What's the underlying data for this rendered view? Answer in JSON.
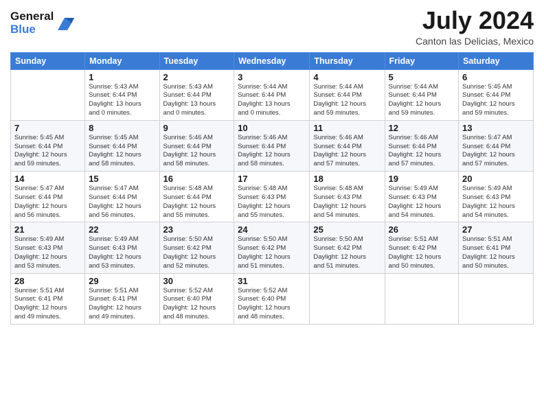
{
  "header": {
    "logo_line1": "General",
    "logo_line2": "Blue",
    "month_title": "July 2024",
    "subtitle": "Canton las Delicias, Mexico"
  },
  "weekdays": [
    "Sunday",
    "Monday",
    "Tuesday",
    "Wednesday",
    "Thursday",
    "Friday",
    "Saturday"
  ],
  "weeks": [
    [
      {
        "day": "",
        "info": ""
      },
      {
        "day": "1",
        "info": "Sunrise: 5:43 AM\nSunset: 6:44 PM\nDaylight: 13 hours\nand 0 minutes."
      },
      {
        "day": "2",
        "info": "Sunrise: 5:43 AM\nSunset: 6:44 PM\nDaylight: 13 hours\nand 0 minutes."
      },
      {
        "day": "3",
        "info": "Sunrise: 5:44 AM\nSunset: 6:44 PM\nDaylight: 13 hours\nand 0 minutes."
      },
      {
        "day": "4",
        "info": "Sunrise: 5:44 AM\nSunset: 6:44 PM\nDaylight: 12 hours\nand 59 minutes."
      },
      {
        "day": "5",
        "info": "Sunrise: 5:44 AM\nSunset: 6:44 PM\nDaylight: 12 hours\nand 59 minutes."
      },
      {
        "day": "6",
        "info": "Sunrise: 5:45 AM\nSunset: 6:44 PM\nDaylight: 12 hours\nand 59 minutes."
      }
    ],
    [
      {
        "day": "7",
        "info": "Sunrise: 5:45 AM\nSunset: 6:44 PM\nDaylight: 12 hours\nand 59 minutes."
      },
      {
        "day": "8",
        "info": "Sunrise: 5:45 AM\nSunset: 6:44 PM\nDaylight: 12 hours\nand 58 minutes."
      },
      {
        "day": "9",
        "info": "Sunrise: 5:46 AM\nSunset: 6:44 PM\nDaylight: 12 hours\nand 58 minutes."
      },
      {
        "day": "10",
        "info": "Sunrise: 5:46 AM\nSunset: 6:44 PM\nDaylight: 12 hours\nand 58 minutes."
      },
      {
        "day": "11",
        "info": "Sunrise: 5:46 AM\nSunset: 6:44 PM\nDaylight: 12 hours\nand 57 minutes."
      },
      {
        "day": "12",
        "info": "Sunrise: 5:46 AM\nSunset: 6:44 PM\nDaylight: 12 hours\nand 57 minutes."
      },
      {
        "day": "13",
        "info": "Sunrise: 5:47 AM\nSunset: 6:44 PM\nDaylight: 12 hours\nand 57 minutes."
      }
    ],
    [
      {
        "day": "14",
        "info": "Sunrise: 5:47 AM\nSunset: 6:44 PM\nDaylight: 12 hours\nand 56 minutes."
      },
      {
        "day": "15",
        "info": "Sunrise: 5:47 AM\nSunset: 6:44 PM\nDaylight: 12 hours\nand 56 minutes."
      },
      {
        "day": "16",
        "info": "Sunrise: 5:48 AM\nSunset: 6:44 PM\nDaylight: 12 hours\nand 55 minutes."
      },
      {
        "day": "17",
        "info": "Sunrise: 5:48 AM\nSunset: 6:43 PM\nDaylight: 12 hours\nand 55 minutes."
      },
      {
        "day": "18",
        "info": "Sunrise: 5:48 AM\nSunset: 6:43 PM\nDaylight: 12 hours\nand 54 minutes."
      },
      {
        "day": "19",
        "info": "Sunrise: 5:49 AM\nSunset: 6:43 PM\nDaylight: 12 hours\nand 54 minutes."
      },
      {
        "day": "20",
        "info": "Sunrise: 5:49 AM\nSunset: 6:43 PM\nDaylight: 12 hours\nand 54 minutes."
      }
    ],
    [
      {
        "day": "21",
        "info": "Sunrise: 5:49 AM\nSunset: 6:43 PM\nDaylight: 12 hours\nand 53 minutes."
      },
      {
        "day": "22",
        "info": "Sunrise: 5:49 AM\nSunset: 6:43 PM\nDaylight: 12 hours\nand 53 minutes."
      },
      {
        "day": "23",
        "info": "Sunrise: 5:50 AM\nSunset: 6:42 PM\nDaylight: 12 hours\nand 52 minutes."
      },
      {
        "day": "24",
        "info": "Sunrise: 5:50 AM\nSunset: 6:42 PM\nDaylight: 12 hours\nand 51 minutes."
      },
      {
        "day": "25",
        "info": "Sunrise: 5:50 AM\nSunset: 6:42 PM\nDaylight: 12 hours\nand 51 minutes."
      },
      {
        "day": "26",
        "info": "Sunrise: 5:51 AM\nSunset: 6:42 PM\nDaylight: 12 hours\nand 50 minutes."
      },
      {
        "day": "27",
        "info": "Sunrise: 5:51 AM\nSunset: 6:41 PM\nDaylight: 12 hours\nand 50 minutes."
      }
    ],
    [
      {
        "day": "28",
        "info": "Sunrise: 5:51 AM\nSunset: 6:41 PM\nDaylight: 12 hours\nand 49 minutes."
      },
      {
        "day": "29",
        "info": "Sunrise: 5:51 AM\nSunset: 6:41 PM\nDaylight: 12 hours\nand 49 minutes."
      },
      {
        "day": "30",
        "info": "Sunrise: 5:52 AM\nSunset: 6:40 PM\nDaylight: 12 hours\nand 48 minutes."
      },
      {
        "day": "31",
        "info": "Sunrise: 5:52 AM\nSunset: 6:40 PM\nDaylight: 12 hours\nand 48 minutes."
      },
      {
        "day": "",
        "info": ""
      },
      {
        "day": "",
        "info": ""
      },
      {
        "day": "",
        "info": ""
      }
    ]
  ]
}
